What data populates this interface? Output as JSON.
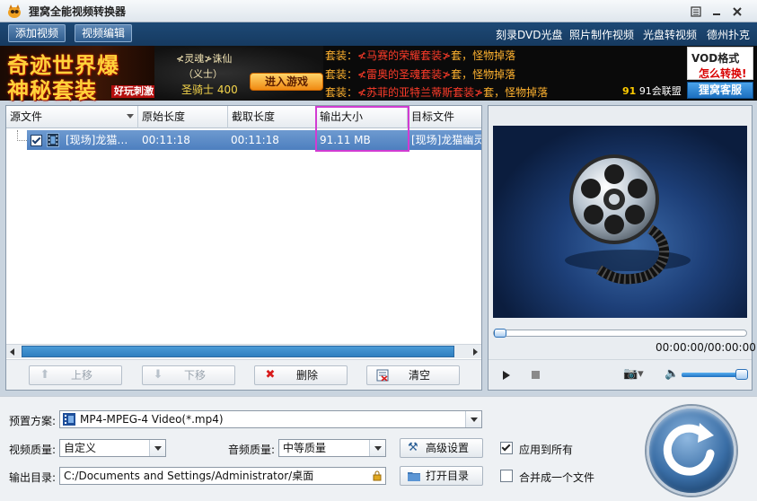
{
  "window": {
    "title": "狸窝全能视频转换器",
    "logo_icon": "raccoon-logo-icon",
    "controls": [
      "restore-icon",
      "minimize-icon",
      "close-icon"
    ]
  },
  "menu": {
    "add_video": "添加视频",
    "edit_video": "视频编辑",
    "links": [
      "刻录DVD光盘",
      "照片制作视频",
      "光盘转视频",
      "德州扑克"
    ]
  },
  "banner": {
    "left_line1": "奇迹世界爆",
    "left_line2": "神秘套装",
    "left_tag": "好玩刺激",
    "mid_line1": "≮灵魂≯诛仙",
    "mid_line2": "（义士）",
    "mid_line3": "圣骑士 400",
    "game_button": "进入游戏",
    "promo_lines": [
      {
        "prefix": "套装：",
        "name": "≮马赛的荣耀套装≯",
        "suffix": "套，怪物掉落"
      },
      {
        "prefix": "套装：",
        "name": "≮雷奥的圣魂套装≯",
        "suffix": "套，怪物掉落"
      },
      {
        "prefix": "套装：",
        "name": "≮苏菲的亚特兰蒂斯套装≯",
        "suffix": "套，怪物掉落"
      }
    ],
    "union_num": "91",
    "union_text": "91会联盟",
    "vod_line1": "VOD格式",
    "vod_line2": "怎么转换!",
    "support_button": "狸窝客服"
  },
  "table": {
    "columns": [
      "源文件",
      "原始长度",
      "截取长度",
      "输出大小",
      "目标文件"
    ],
    "rows": [
      {
        "checked": true,
        "source": "[现场]龙猫…",
        "original_length": "00:11:18",
        "clip_length": "00:11:18",
        "output_size": "91.11 MB",
        "target": "[现场]龙猫幽灵."
      }
    ],
    "buttons": {
      "move_up": "上移",
      "move_down": "下移",
      "delete": "删除",
      "clear": "清空"
    }
  },
  "preview": {
    "timecode": "00:00:00/00:00:00",
    "seek_progress": 0,
    "volume_level": 0.95
  },
  "settings": {
    "preset_label": "预置方案:",
    "preset_value": "MP4-MPEG-4 Video(*.mp4)",
    "video_quality_label": "视频质量:",
    "video_quality_value": "自定义",
    "audio_quality_label": "音频质量:",
    "audio_quality_value": "中等质量",
    "advanced_button": "高级设置",
    "apply_all_label": "应用到所有",
    "apply_all_checked": true,
    "output_dir_label": "输出目录:",
    "output_dir_value": "C:/Documents and Settings/Administrator/桌面",
    "open_dir_button": "打开目录",
    "merge_label": "合并成一个文件",
    "merge_checked": false
  },
  "colors": {
    "menubar": "#1d4976",
    "selected_row": "#5b8bc8",
    "highlight_box": "#d23bd2",
    "banner_gold": "#ffd23a"
  }
}
